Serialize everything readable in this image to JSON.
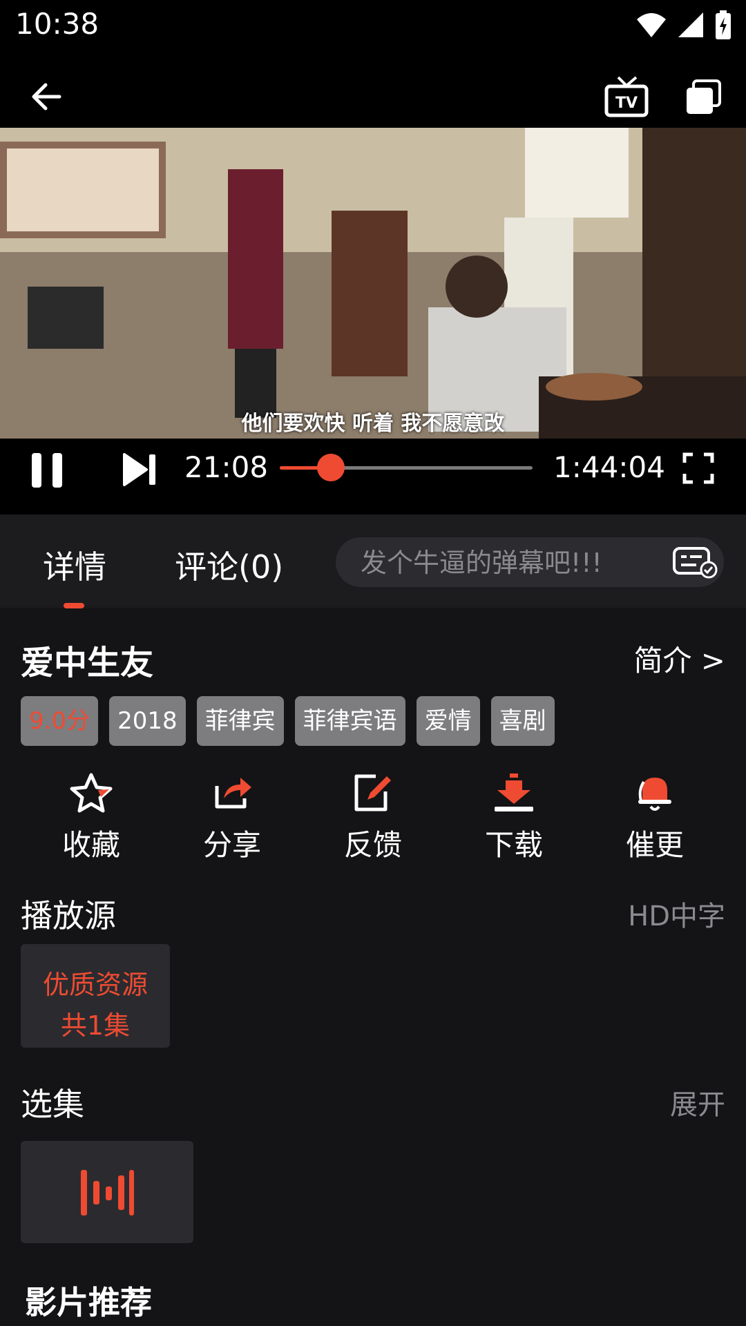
{
  "status": {
    "time": "10:38"
  },
  "player": {
    "subtitle": "他们要欢快 听着 我不愿意改",
    "current_time": "21:08",
    "total_time": "1:44:04",
    "progress_fraction": 0.2032,
    "accent": "#ef4b32"
  },
  "tabs": [
    {
      "label": "详情",
      "active": true
    },
    {
      "label": "评论(0)",
      "active": false
    }
  ],
  "danmaku": {
    "placeholder": "发个牛逼的弹幕吧!!!"
  },
  "movie": {
    "title": "爱中生友",
    "intro_link": "简介 >",
    "tags": [
      "9.0分",
      "2018",
      "菲律宾",
      "菲律宾语",
      "爱情",
      "喜剧"
    ]
  },
  "actions": [
    {
      "label": "收藏",
      "icon": "star-icon"
    },
    {
      "label": "分享",
      "icon": "share-icon"
    },
    {
      "label": "反馈",
      "icon": "edit-icon"
    },
    {
      "label": "下载",
      "icon": "download-icon"
    },
    {
      "label": "催更",
      "icon": "bell-icon"
    }
  ],
  "source": {
    "title": "播放源",
    "quality": "HD中字",
    "card_line1": "优质资源",
    "card_line2": "共1集"
  },
  "episodes": {
    "title": "选集",
    "expand": "展开"
  },
  "recommend": {
    "title": "影片推荐"
  }
}
